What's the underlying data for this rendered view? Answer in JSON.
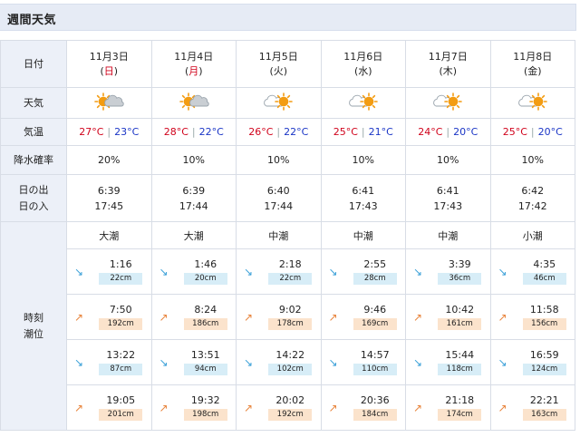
{
  "header": {
    "title": "週間天気"
  },
  "labels": {
    "date": "日付",
    "weather": "天気",
    "temp": "気温",
    "rain": "降水確率",
    "sunrise": "日の出",
    "sunset": "日の入",
    "tide_time": "時刻",
    "tide_level": "潮位"
  },
  "days": [
    {
      "date": "11月3日",
      "dow": "日",
      "weather": "sun-cloud",
      "high": "27°C",
      "low": "23°C",
      "rain": "20%",
      "sunrise": "6:39",
      "sunset": "17:45",
      "tide_type": "大潮",
      "tides": [
        {
          "dir": "down",
          "time": "1:16",
          "level": "22cm"
        },
        {
          "dir": "up",
          "time": "7:50",
          "level": "192cm"
        },
        {
          "dir": "down",
          "time": "13:22",
          "level": "87cm"
        },
        {
          "dir": "up",
          "time": "19:05",
          "level": "201cm"
        }
      ]
    },
    {
      "date": "11月4日",
      "dow": "月",
      "weather": "sun-cloud",
      "high": "28°C",
      "low": "22°C",
      "rain": "10%",
      "sunrise": "6:39",
      "sunset": "17:44",
      "tide_type": "大潮",
      "tides": [
        {
          "dir": "down",
          "time": "1:46",
          "level": "20cm"
        },
        {
          "dir": "up",
          "time": "8:24",
          "level": "186cm"
        },
        {
          "dir": "down",
          "time": "13:51",
          "level": "94cm"
        },
        {
          "dir": "up",
          "time": "19:32",
          "level": "198cm"
        }
      ]
    },
    {
      "date": "11月5日",
      "dow": "火",
      "weather": "cloud-sun",
      "high": "26°C",
      "low": "22°C",
      "rain": "10%",
      "sunrise": "6:40",
      "sunset": "17:44",
      "tide_type": "中潮",
      "tides": [
        {
          "dir": "down",
          "time": "2:18",
          "level": "22cm"
        },
        {
          "dir": "up",
          "time": "9:02",
          "level": "178cm"
        },
        {
          "dir": "down",
          "time": "14:22",
          "level": "102cm"
        },
        {
          "dir": "up",
          "time": "20:02",
          "level": "192cm"
        }
      ]
    },
    {
      "date": "11月6日",
      "dow": "水",
      "weather": "cloud-sun",
      "high": "25°C",
      "low": "21°C",
      "rain": "10%",
      "sunrise": "6:41",
      "sunset": "17:43",
      "tide_type": "中潮",
      "tides": [
        {
          "dir": "down",
          "time": "2:55",
          "level": "28cm"
        },
        {
          "dir": "up",
          "time": "9:46",
          "level": "169cm"
        },
        {
          "dir": "down",
          "time": "14:57",
          "level": "110cm"
        },
        {
          "dir": "up",
          "time": "20:36",
          "level": "184cm"
        }
      ]
    },
    {
      "date": "11月7日",
      "dow": "木",
      "weather": "cloud-sun",
      "high": "24°C",
      "low": "20°C",
      "rain": "10%",
      "sunrise": "6:41",
      "sunset": "17:43",
      "tide_type": "中潮",
      "tides": [
        {
          "dir": "down",
          "time": "3:39",
          "level": "36cm"
        },
        {
          "dir": "up",
          "time": "10:42",
          "level": "161cm"
        },
        {
          "dir": "down",
          "time": "15:44",
          "level": "118cm"
        },
        {
          "dir": "up",
          "time": "21:18",
          "level": "174cm"
        }
      ]
    },
    {
      "date": "11月8日",
      "dow": "金",
      "weather": "cloud-sun",
      "high": "25°C",
      "low": "20°C",
      "rain": "10%",
      "sunrise": "6:42",
      "sunset": "17:42",
      "tide_type": "小潮",
      "tides": [
        {
          "dir": "down",
          "time": "4:35",
          "level": "46cm"
        },
        {
          "dir": "up",
          "time": "11:58",
          "level": "156cm"
        },
        {
          "dir": "down",
          "time": "16:59",
          "level": "124cm"
        },
        {
          "dir": "up",
          "time": "22:21",
          "level": "163cm"
        }
      ]
    }
  ],
  "colors": {
    "high_temp": "#d0021b",
    "low_temp": "#1a35c6",
    "label_bg": "#ecf0f8",
    "low_tide_bg": "#d7edf7",
    "high_tide_bg": "#fbe3cc"
  },
  "icons": {
    "falling_tide": "falling-tide-arrow-icon",
    "rising_tide": "rising-tide-arrow-icon"
  }
}
